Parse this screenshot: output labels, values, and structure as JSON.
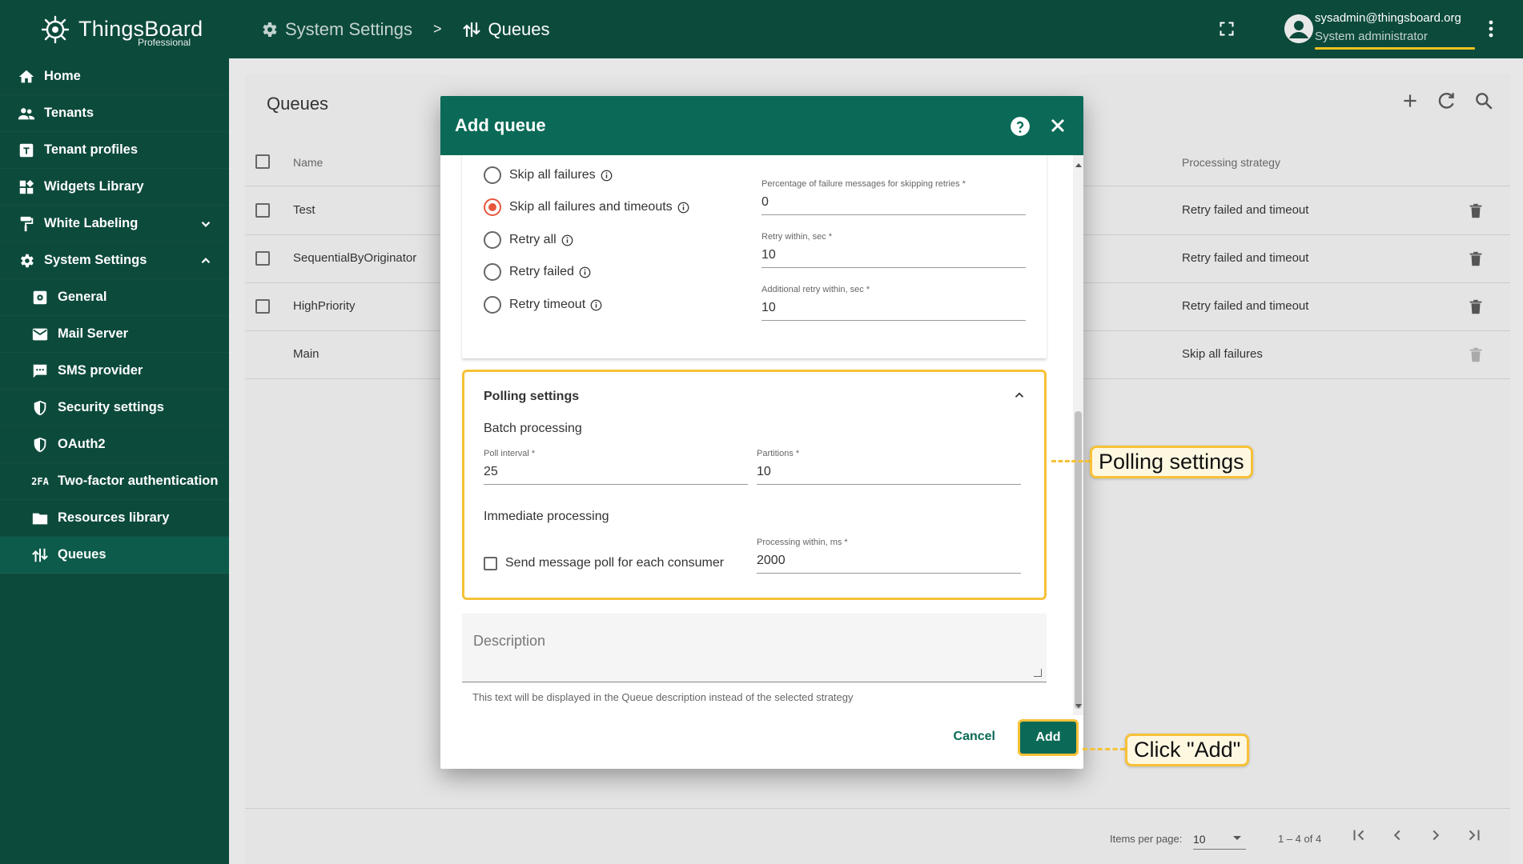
{
  "brand": {
    "name": "ThingsBoard",
    "sub": "Professional"
  },
  "sidebar": {
    "items": [
      {
        "label": "Home",
        "icon": "home-icon"
      },
      {
        "label": "Tenants",
        "icon": "people-icon"
      },
      {
        "label": "Tenant profiles",
        "icon": "tenant-profile-icon"
      },
      {
        "label": "Widgets Library",
        "icon": "widgets-icon"
      },
      {
        "label": "White Labeling",
        "icon": "paint-roller-icon"
      },
      {
        "label": "System Settings",
        "icon": "gear-icon"
      },
      {
        "label": "General",
        "icon": "settings-box-icon"
      },
      {
        "label": "Mail Server",
        "icon": "mail-icon"
      },
      {
        "label": "SMS provider",
        "icon": "sms-icon"
      },
      {
        "label": "Security settings",
        "icon": "shield-icon"
      },
      {
        "label": "OAuth2",
        "icon": "shield-icon"
      },
      {
        "label": "Two-factor authentication",
        "icon": "2fa-icon",
        "icon_text": "2FA"
      },
      {
        "label": "Resources library",
        "icon": "folder-icon"
      },
      {
        "label": "Queues",
        "icon": "queues-icon"
      }
    ]
  },
  "topbar": {
    "crumb_1": "System Settings",
    "crumb_sep": ">",
    "crumb_2": "Queues",
    "user_email": "sysadmin@thingsboard.org",
    "user_role": "System administrator"
  },
  "card": {
    "title": "Queues",
    "columns": {
      "name": "Name",
      "strategy": "Processing strategy"
    },
    "rows": [
      {
        "name": "Test",
        "strategy": "Retry failed and timeout"
      },
      {
        "name": "SequentialByOriginator",
        "strategy": "Retry failed and timeout"
      },
      {
        "name": "HighPriority",
        "strategy": "Retry failed and timeout"
      },
      {
        "name": "Main",
        "strategy": "Skip all failures"
      }
    ],
    "paginator": {
      "label": "Items per page:",
      "value": "10",
      "range": "1 – 4 of 4"
    }
  },
  "dialog": {
    "title": "Add queue",
    "radios": [
      {
        "label": "Skip all failures",
        "selected": false
      },
      {
        "label": "Skip all failures and timeouts",
        "selected": true
      },
      {
        "label": "Retry all",
        "selected": false
      },
      {
        "label": "Retry failed",
        "selected": false
      },
      {
        "label": "Retry timeout",
        "selected": false
      }
    ],
    "fields": [
      {
        "label": "Percentage of failure messages for skipping retries *",
        "value": "0"
      },
      {
        "label": "Retry within, sec *",
        "value": "10"
      },
      {
        "label": "Additional retry within, sec *",
        "value": "10"
      }
    ],
    "polling": {
      "title": "Polling settings",
      "batch_title": "Batch processing",
      "poll_interval": {
        "label": "Poll interval *",
        "value": "25"
      },
      "partitions": {
        "label": "Partitions *",
        "value": "10"
      },
      "immediate_title": "Immediate processing",
      "checkbox_label": "Send message poll for each consumer",
      "processing_within": {
        "label": "Processing within, ms *",
        "value": "2000"
      }
    },
    "description": {
      "placeholder": "Description",
      "hint": "This text will be displayed in the Queue description instead of the selected strategy"
    },
    "cancel_label": "Cancel",
    "add_label": "Add"
  },
  "callouts": {
    "polling": "Polling settings",
    "add": "Click \"Add\""
  },
  "colors": {
    "primary": "#0c4a3c",
    "accent": "#0a6a57",
    "highlight": "#f7c137",
    "radio": "#e8563e"
  }
}
